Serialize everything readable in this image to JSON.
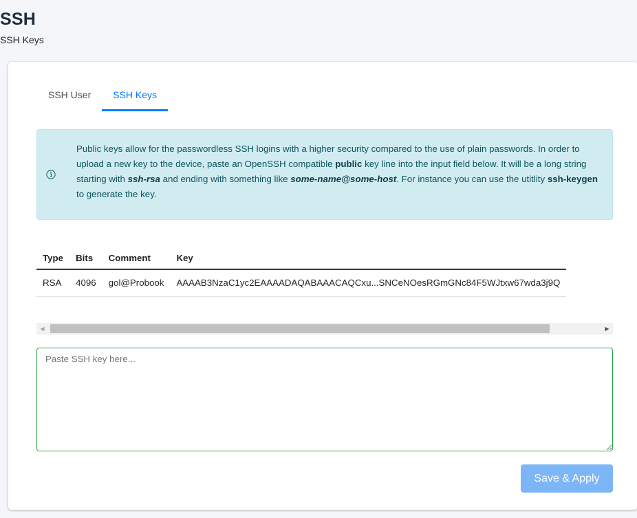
{
  "header": {
    "title": "SSH",
    "subtitle": "SSH Keys"
  },
  "tabs": [
    {
      "label": "SSH User",
      "active": false
    },
    {
      "label": "SSH Keys",
      "active": true
    }
  ],
  "alert": {
    "icon": "info-circle-icon",
    "text_1": "Public keys allow for the passwordless SSH logins with a higher security compared to the use of plain passwords. In order to upload a new key to the device, paste an OpenSSH compatible ",
    "bold_1": "public",
    "text_2": " key line into the input field below. It will be a long string starting with ",
    "bold_2": "ssh-rsa",
    "text_3": " and ending with something like ",
    "bold_3": "some-name@some-host",
    "text_4": ". For instance you can use the utitlity ",
    "bold_4": "ssh-keygen",
    "text_5": " to generate the key."
  },
  "table": {
    "headers": [
      "Type",
      "Bits",
      "Comment",
      "Key"
    ],
    "rows": [
      [
        "RSA",
        "4096",
        "gol@Probook",
        "AAAAB3NzaC1yc2EAAAADAQABAAACAQCxu...SNCeNOesRGmGNc84F5WJtxw67wda3j9Q"
      ]
    ]
  },
  "key_input": {
    "value": "",
    "placeholder": "Paste SSH key here..."
  },
  "save_button": {
    "label": "Save & Apply"
  },
  "colors": {
    "accent": "#007bff",
    "alert_bg": "#d1ecf1",
    "alert_text": "#0c5460",
    "textarea_border": "#28a745",
    "button_bg": "#7cb6f6"
  }
}
